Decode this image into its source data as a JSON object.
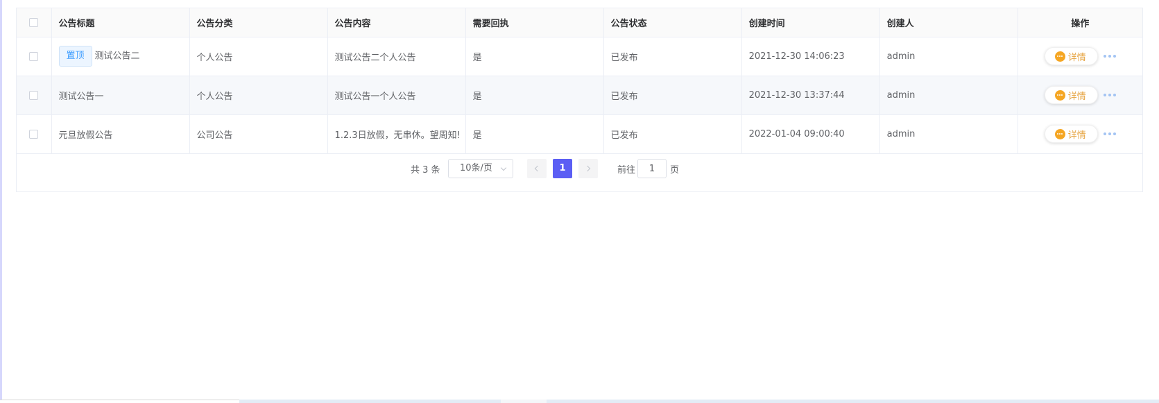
{
  "table": {
    "columns": {
      "title": "公告标题",
      "category": "公告分类",
      "content": "公告内容",
      "receipt": "需要回执",
      "status": "公告状态",
      "created_at": "创建时间",
      "creator": "创建人",
      "actions": "操作"
    },
    "rows": [
      {
        "pin_tag": "置顶",
        "title": "测试公告二",
        "category": "个人公告",
        "content": "测试公告二个人公告",
        "receipt": "是",
        "status": "已发布",
        "created_at": "2021-12-30 14:06:23",
        "creator": "admin",
        "detail_label": "详情"
      },
      {
        "title": "测试公告一",
        "category": "个人公告",
        "content": "测试公告一个人公告",
        "receipt": "是",
        "status": "已发布",
        "created_at": "2021-12-30 13:37:44",
        "creator": "admin",
        "detail_label": "详情"
      },
      {
        "title": "元旦放假公告",
        "category": "公司公告",
        "content": "1.2.3日放假，无串休。望周知!",
        "receipt": "是",
        "status": "已发布",
        "created_at": "2022-01-04 09:00:40",
        "creator": "admin",
        "detail_label": "详情"
      }
    ]
  },
  "pagination": {
    "total": "共 3 条",
    "page_size": "10条/页",
    "current_page": "1",
    "goto_label": "前往",
    "goto_value": "1",
    "goto_suffix": "页"
  },
  "colors": {
    "accent": "#5b5ef4",
    "pin_tag": "#409eff",
    "detail": "#e6a23c",
    "more": "#a3c4f3"
  },
  "icons": {
    "detail": "more-circle-icon",
    "more": "ellipsis-icon",
    "prev": "chevron-left-icon",
    "next": "chevron-right-icon",
    "size_dropdown": "chevron-down-icon"
  }
}
